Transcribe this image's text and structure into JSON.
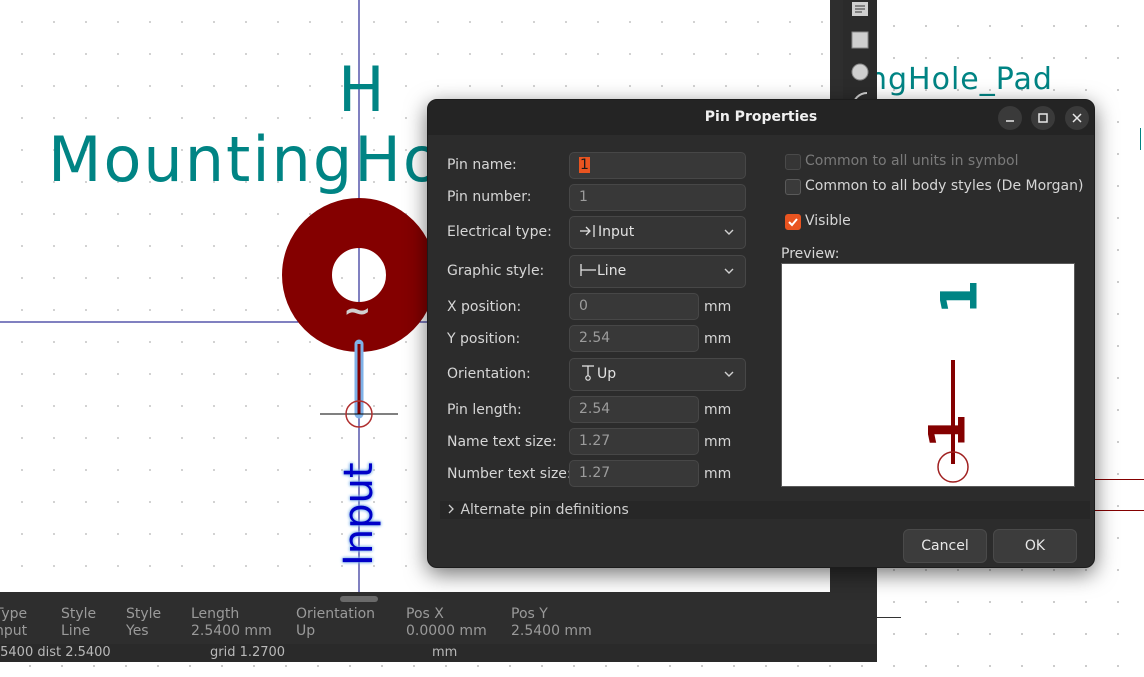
{
  "schematic": {
    "ref_text": "ngHole_Pad"
  },
  "symbol": {
    "reference": "H",
    "value": "MountingHo",
    "pin_name": "Input",
    "pad_mark": "~"
  },
  "status_bar": {
    "columns": [
      {
        "header": "Type",
        "value": "nput"
      },
      {
        "header": "Style",
        "value": "Line"
      },
      {
        "header": "Style",
        "value": "Yes"
      },
      {
        "header": "Length",
        "value": "2.5400 mm"
      },
      {
        "header": "Orientation",
        "value": "Up"
      },
      {
        "header": "Pos X",
        "value": "0.0000 mm"
      },
      {
        "header": "Pos Y",
        "value": "2.5400 mm"
      }
    ],
    "coords": ".5400  dist 2.5400",
    "grid": "grid 1.2700",
    "units": "mm"
  },
  "dialog": {
    "title": "Pin Properties",
    "fields": {
      "pin_name": {
        "label": "Pin name:",
        "value": "1"
      },
      "pin_number": {
        "label": "Pin number:",
        "value": "1"
      },
      "electrical_type": {
        "label": "Electrical type:",
        "value": "Input"
      },
      "graphic_style": {
        "label": "Graphic style:",
        "value": "Line"
      },
      "x_position": {
        "label": "X position:",
        "value": "0",
        "unit": "mm"
      },
      "y_position": {
        "label": "Y position:",
        "value": "2.54",
        "unit": "mm"
      },
      "orientation": {
        "label": "Orientation:",
        "value": "Up"
      },
      "pin_length": {
        "label": "Pin length:",
        "value": "2.54",
        "unit": "mm"
      },
      "name_text_size": {
        "label": "Name text size:",
        "value": "1.27",
        "unit": "mm"
      },
      "number_text_size": {
        "label": "Number text size:",
        "value": "1.27",
        "unit": "mm"
      }
    },
    "checkboxes": {
      "common_units": {
        "label": "Common to all units in symbol",
        "checked": false,
        "enabled": false
      },
      "common_body_styles": {
        "label": "Common to all body styles (De Morgan)",
        "checked": false,
        "enabled": true
      },
      "visible": {
        "label": "Visible",
        "checked": true,
        "enabled": true
      }
    },
    "preview_label": "Preview:",
    "preview_pin_number": "1",
    "preview_pin_name": "1",
    "alternate_label": "Alternate pin definitions",
    "cancel_label": "Cancel",
    "ok_label": "OK"
  },
  "colors": {
    "accent": "#e95420",
    "symbol_text": "#008484",
    "pad": "#840000",
    "pin_name_text": "#0000c8"
  }
}
